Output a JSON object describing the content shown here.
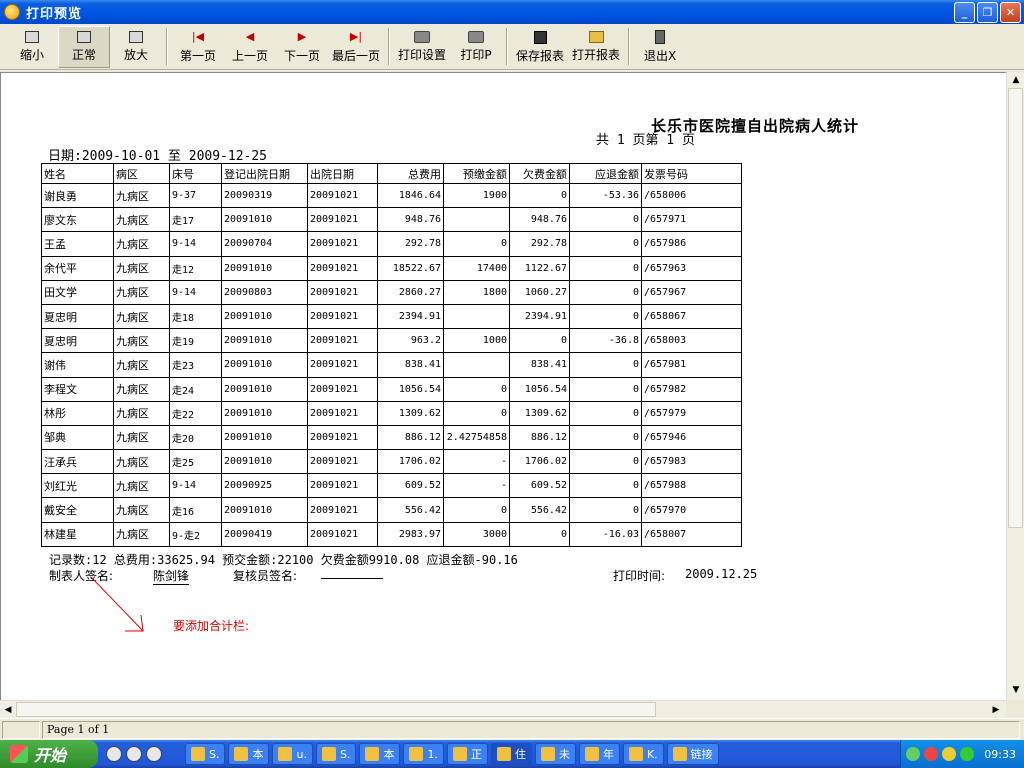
{
  "window": {
    "title": "打印预览"
  },
  "toolbar": {
    "zoom_out": "缩小",
    "normal": "正常",
    "zoom_in": "放大",
    "first_page": "第一页",
    "prev_page": "上一页",
    "next_page": "下一页",
    "last_page": "最后一页",
    "print_setup": "打印设置",
    "print": "打印P",
    "save_report": "保存报表",
    "open_report": "打开报表",
    "exit": "退出X"
  },
  "report": {
    "title": "长乐市医院擅自出院病人统计",
    "pages": "共  1  页第  1  页",
    "date_range": "日期:2009-10-01 至 2009-12-25",
    "columns": [
      "姓名",
      "病区",
      "床号",
      "登记出院日期",
      "出院日期",
      "总费用",
      "预缴金额",
      "欠费金额",
      "应退金额",
      "发票号码"
    ],
    "rows": [
      [
        "谢良勇",
        "九病区",
        "9-37",
        "20090319",
        "20091021",
        "1846.64",
        "1900",
        "0",
        "-53.36",
        "/658006"
      ],
      [
        "廖文东",
        "九病区",
        "走17",
        "20091010",
        "20091021",
        "948.76",
        "",
        "948.76",
        "0",
        "/657971"
      ],
      [
        "王孟",
        "九病区",
        "9-14",
        "20090704",
        "20091021",
        "292.78",
        "0",
        "292.78",
        "0",
        "/657986"
      ],
      [
        "余代平",
        "九病区",
        "走12",
        "20091010",
        "20091021",
        "18522.67",
        "17400",
        "1122.67",
        "0",
        "/657963"
      ],
      [
        "田文学",
        "九病区",
        "9-14",
        "20090803",
        "20091021",
        "2860.27",
        "1800",
        "1060.27",
        "0",
        "/657967"
      ],
      [
        "夏忠明",
        "九病区",
        "走18",
        "20091010",
        "20091021",
        "2394.91",
        "",
        "2394.91",
        "0",
        "/658067"
      ],
      [
        "夏忠明",
        "九病区",
        "走19",
        "20091010",
        "20091021",
        "963.2",
        "1000",
        "0",
        "-36.8",
        "/658003"
      ],
      [
        "谢伟",
        "九病区",
        "走23",
        "20091010",
        "20091021",
        "838.41",
        "",
        "838.41",
        "0",
        "/657981"
      ],
      [
        "李程文",
        "九病区",
        "走24",
        "20091010",
        "20091021",
        "1056.54",
        "0",
        "1056.54",
        "0",
        "/657982"
      ],
      [
        "林彤",
        "九病区",
        "走22",
        "20091010",
        "20091021",
        "1309.62",
        "0",
        "1309.62",
        "0",
        "/657979"
      ],
      [
        "邹典",
        "九病区",
        "走20",
        "20091010",
        "20091021",
        "886.12",
        "2.42754858",
        "886.12",
        "0",
        "/657946"
      ],
      [
        "汪承兵",
        "九病区",
        "走25",
        "20091010",
        "20091021",
        "1706.02",
        "-",
        "1706.02",
        "0",
        "/657983"
      ],
      [
        "刘红光",
        "九病区",
        "9-14",
        "20090925",
        "20091021",
        "609.52",
        "-",
        "609.52",
        "0",
        "/657988"
      ],
      [
        "戴安全",
        "九病区",
        "走16",
        "20091010",
        "20091021",
        "556.42",
        "0",
        "556.42",
        "0",
        "/657970"
      ],
      [
        "林建星",
        "九病区",
        "9-走2",
        "20090419",
        "20091021",
        "2983.97",
        "3000",
        "0",
        "-16.03",
        "/658007"
      ]
    ],
    "summary": "记录数:12 总费用:33625.94 预交金额:22100 欠费金额9910.08 应退金额-90.16",
    "maker_label": "制表人签名:",
    "maker_name": "陈剑锋",
    "reviewer_label": "复核员签名:",
    "print_time_label": "打印时间:",
    "print_time": "2009.12.25",
    "annotation": "要添加合计栏:"
  },
  "status": {
    "page_info": "Page 1 of 1"
  },
  "taskbar": {
    "start": "开始",
    "tasks": [
      "S.",
      "本",
      "u.",
      "S.",
      "本",
      "1.",
      "正",
      "住",
      "未",
      "年",
      "K.",
      "链接"
    ],
    "clock": "09:33"
  },
  "colors": {
    "title_bar": "#0054e3",
    "annotation": "#e00000",
    "taskbar": "#245edb"
  }
}
